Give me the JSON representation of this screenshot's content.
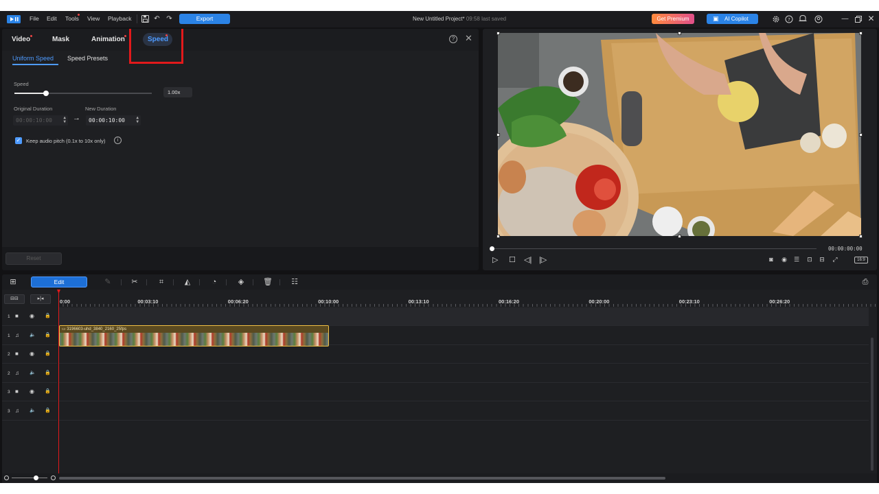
{
  "menu": {
    "file": "File",
    "edit": "Edit",
    "tools": "Tools",
    "view": "View",
    "playback": "Playback"
  },
  "toolbar": {
    "export": "Export",
    "get_premium": "Get Premium",
    "ai_copilot": "AI Copilot"
  },
  "project": {
    "title": "New Untitled Project*",
    "saved": "09:58 last saved"
  },
  "left_panel": {
    "tabs": [
      "Video",
      "Mask",
      "Animation",
      "Speed"
    ],
    "active_tab": "Speed",
    "sub_tabs": [
      "Uniform Speed",
      "Speed Presets"
    ],
    "speed_label": "Speed",
    "speed_value": "1.00x",
    "speed_level_fraction": 0.23,
    "original_duration_label": "Original Duration",
    "new_duration_label": "New Duration",
    "original_duration": "00:00:10:00",
    "new_duration": "00:00:10:00",
    "keep_pitch_label": "Keep audio pitch (0.1x to 10x only)",
    "keep_pitch_checked": true,
    "reset": "Reset"
  },
  "preview": {
    "timecode": "00:00:00:00",
    "aspect": "16:9"
  },
  "timeline": {
    "edit_button": "Edit",
    "ruler_labels": [
      "0:00",
      "00:03:10",
      "00:06:20",
      "00:10:00",
      "00:13:10",
      "00:16:20",
      "00:20:00",
      "00:23:10",
      "00:26:20"
    ],
    "clip_name": "3196603-uhd_3840_2160_25fps",
    "tracks": [
      {
        "num": "1",
        "type": "video"
      },
      {
        "num": "1",
        "type": "audio"
      },
      {
        "num": "2",
        "type": "video"
      },
      {
        "num": "2",
        "type": "audio"
      },
      {
        "num": "3",
        "type": "video"
      },
      {
        "num": "3",
        "type": "audio"
      }
    ]
  },
  "colors": {
    "accent": "#4e9bff",
    "export": "#2b83e6",
    "highlight": "#e2191b",
    "clip_border": "#f0c044",
    "playhead": "#e2191b"
  }
}
